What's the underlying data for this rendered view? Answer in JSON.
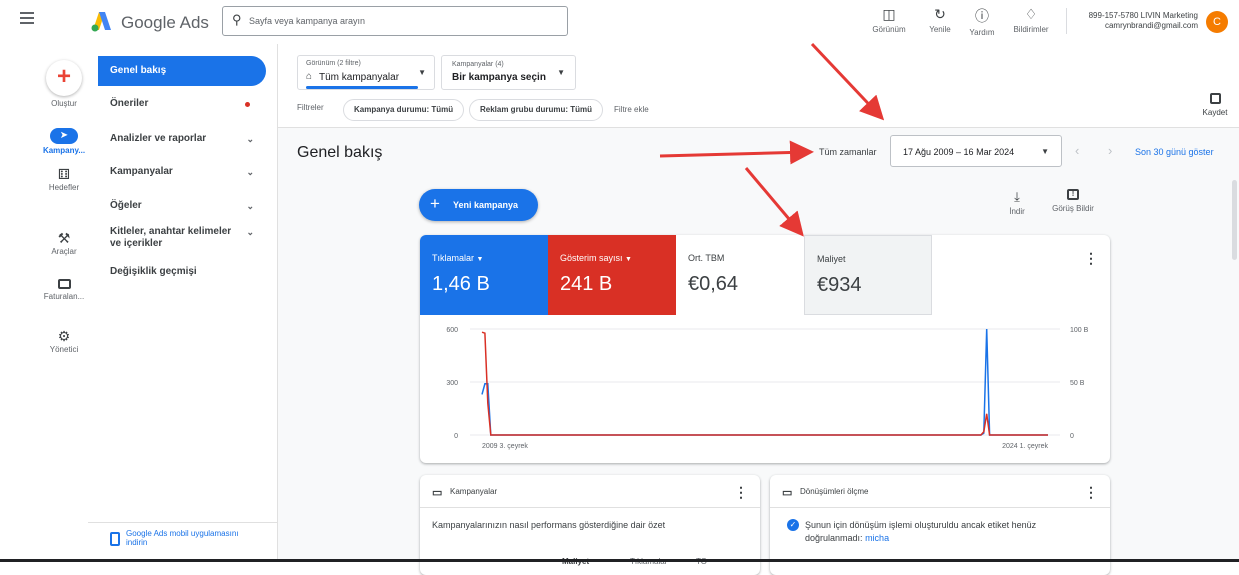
{
  "header": {
    "app_name": "Google Ads",
    "search_placeholder": "Sayfa veya kampanya arayın",
    "actions": [
      {
        "label": "Görünüm",
        "icon": "appearance-icon"
      },
      {
        "label": "Yenile",
        "icon": "refresh-icon"
      },
      {
        "label": "Yardım",
        "icon": "help-icon"
      },
      {
        "label": "Bildirimler",
        "icon": "bell-icon"
      }
    ],
    "account_id": "899-157-5780 LIVIN Marketing",
    "account_email": "camrynbrandi@gmail.com",
    "avatar_letter": "C"
  },
  "rail": {
    "create_label": "Oluştur",
    "items": [
      {
        "label": "Kampany...",
        "icon": "campaigns-icon"
      },
      {
        "label": "Hedefler",
        "icon": "trophy-icon"
      },
      {
        "label": "Araçlar",
        "icon": "tools-icon"
      },
      {
        "label": "Faturalan...",
        "icon": "billing-card-icon"
      },
      {
        "label": "Yönetici",
        "icon": "admin-gear-icon"
      }
    ]
  },
  "nav": {
    "items": [
      {
        "label": "Genel bakış"
      },
      {
        "label": "Öneriler"
      },
      {
        "label": "Analizler ve raporlar"
      },
      {
        "label": "Kampanyalar"
      },
      {
        "label": "Öğeler"
      },
      {
        "label": "Kitleler, anahtar kelimeler",
        "label2": "ve içerikler"
      },
      {
        "label": "Değişiklik geçmişi"
      }
    ],
    "mobile_app_line1": "Google Ads mobil uygulamasını",
    "mobile_app_line2": "indirin"
  },
  "filters_bar": {
    "view_caption": "Görünüm (2 filtre)",
    "view_value": "Tüm kampanyalar",
    "campaigns_caption": "Kampanyalar (4)",
    "campaigns_value": "Bir kampanya seçin",
    "filters_label": "Filtreler",
    "chips": [
      "Kampanya durumu: Tümü",
      "Reklam grubu durumu: Tümü"
    ],
    "add_filter": "Filtre ekle",
    "save_label": "Kaydet"
  },
  "page": {
    "title": "Genel bakış",
    "range_caption": "Tüm zamanlar",
    "date_range": "17 Ağu 2009 – 16 Mar 2024",
    "last30": "Son 30 günü göster",
    "new_campaign": "Yeni kampanya",
    "download": "İndir",
    "feedback": "Görüş Bildir"
  },
  "metrics": [
    {
      "label": "Tıklamalar",
      "value": "1,46 B",
      "color": "#1a73e8"
    },
    {
      "label": "Gösterim sayısı",
      "value": "241 B",
      "color": "#d93025"
    },
    {
      "label": "Ort. TBM",
      "value": "€0,64"
    },
    {
      "label": "Maliyet",
      "value": "€934"
    }
  ],
  "chart_data": {
    "type": "line",
    "x_tick_labels": [
      "2009 3. çeyrek",
      "2024 1. çeyrek"
    ],
    "y_left_ticks": [
      "600",
      "300",
      "0"
    ],
    "y_right_ticks": [
      "100 B",
      "50 B",
      "0"
    ],
    "ylim_left": [
      0,
      600
    ],
    "ylim_right": [
      0,
      100
    ],
    "series": [
      {
        "name": "Tıklamalar",
        "color": "#1a73e8",
        "axis": "left",
        "values": [
          230,
          290,
          290,
          0,
          0,
          0,
          0,
          0,
          0,
          0,
          0,
          0,
          0,
          0,
          0,
          0,
          0,
          0,
          0,
          0,
          0,
          0,
          0,
          0,
          0,
          0,
          0,
          0,
          0,
          0,
          0,
          0,
          0,
          0,
          0,
          0,
          0,
          0,
          0,
          0,
          0,
          0,
          0,
          0,
          0,
          0,
          0,
          0,
          0,
          0,
          0,
          0,
          0,
          0,
          0,
          0,
          0,
          0,
          0,
          0,
          0,
          0,
          0,
          0,
          0,
          0,
          0,
          0,
          0,
          0,
          0,
          0,
          0,
          0,
          0,
          0,
          0,
          0,
          0,
          0,
          0,
          0,
          0,
          0,
          0,
          0,
          0,
          0,
          0,
          0,
          0,
          0,
          0,
          0,
          0,
          0,
          0,
          0,
          0,
          0,
          0,
          0,
          0,
          0,
          0,
          0,
          0,
          0,
          0,
          0,
          0,
          0,
          0,
          0,
          0,
          0,
          0,
          0,
          0,
          0,
          0,
          0,
          0,
          0,
          0,
          0,
          0,
          0,
          0,
          0,
          0,
          0,
          0,
          0,
          0,
          0,
          0,
          0,
          0,
          0,
          0,
          0,
          0,
          0,
          0,
          0,
          0,
          0,
          0,
          0,
          0,
          0,
          0,
          0,
          0,
          0,
          0,
          0,
          0,
          0,
          0,
          0,
          0,
          0,
          0,
          0,
          0,
          0,
          0,
          0,
          0,
          0,
          10,
          600,
          0,
          0,
          0,
          0,
          0,
          0,
          0,
          0,
          0,
          0,
          0,
          0,
          0,
          0,
          0,
          0,
          0,
          0,
          0,
          0,
          0
        ]
      },
      {
        "name": "Gösterim sayısı",
        "color": "#d93025",
        "axis": "right",
        "values": [
          97,
          96,
          30,
          0,
          0,
          0,
          0,
          0,
          0,
          0,
          0,
          0,
          0,
          0,
          0,
          0,
          0,
          0,
          0,
          0,
          0,
          0,
          0,
          0,
          0,
          0,
          0,
          0,
          0,
          0,
          0,
          0,
          0,
          0,
          0,
          0,
          0,
          0,
          0,
          0,
          0,
          0,
          0,
          0,
          0,
          0,
          0,
          0,
          0,
          0,
          0,
          0,
          0,
          0,
          0,
          0,
          0,
          0,
          0,
          0,
          0,
          0,
          0,
          0,
          0,
          0,
          0,
          0,
          0,
          0,
          0,
          0,
          0,
          0,
          0,
          0,
          0,
          0,
          0,
          0,
          0,
          0,
          0,
          0,
          0,
          0,
          0,
          0,
          0,
          0,
          0,
          0,
          0,
          0,
          0,
          0,
          0,
          0,
          0,
          0,
          0,
          0,
          0,
          0,
          0,
          0,
          0,
          0,
          0,
          0,
          0,
          0,
          0,
          0,
          0,
          0,
          0,
          0,
          0,
          0,
          0,
          0,
          0,
          0,
          0,
          0,
          0,
          0,
          0,
          0,
          0,
          0,
          0,
          0,
          0,
          0,
          0,
          0,
          0,
          0,
          0,
          0,
          0,
          0,
          0,
          0,
          0,
          0,
          0,
          0,
          0,
          0,
          0,
          0,
          0,
          0,
          0,
          0,
          0,
          0,
          0,
          0,
          0,
          0,
          0,
          0,
          0,
          0,
          0,
          0,
          0,
          0,
          3,
          20,
          0,
          0,
          0,
          0,
          0,
          0,
          0,
          0,
          0,
          0,
          0,
          0,
          0,
          0,
          0,
          0,
          0,
          0,
          0,
          0,
          0
        ]
      }
    ],
    "grid": true
  },
  "cards": {
    "campaigns_title": "Kampanyalar",
    "campaigns_summary": "Kampanyalarınızın nasıl performans gösterdiğine dair özet",
    "campaigns_cols": [
      "Maliyet",
      "Tıklamalar",
      "TO"
    ],
    "conversions_title": "Dönüşümleri ölçme",
    "conversions_text1": "Şunun için dönüşüm işlemi oluşturuldu ancak etiket henüz",
    "conversions_text2": "doğrulanmadı:",
    "conversions_link": "micha"
  },
  "colors": {
    "accent": "#1a73e8",
    "arrow": "#e53935"
  }
}
